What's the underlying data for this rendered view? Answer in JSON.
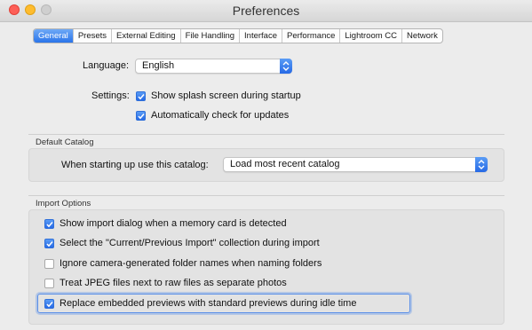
{
  "window": {
    "title": "Preferences"
  },
  "tabs": [
    {
      "label": "General",
      "active": true
    },
    {
      "label": "Presets"
    },
    {
      "label": "External Editing"
    },
    {
      "label": "File Handling"
    },
    {
      "label": "Interface"
    },
    {
      "label": "Performance"
    },
    {
      "label": "Lightroom CC"
    },
    {
      "label": "Network"
    }
  ],
  "language": {
    "label": "Language:",
    "value": "English"
  },
  "settings": {
    "label": "Settings:",
    "splash": {
      "label": "Show splash screen during startup",
      "checked": true
    },
    "updates": {
      "label": "Automatically check for updates",
      "checked": true
    }
  },
  "default_catalog": {
    "title": "Default Catalog",
    "label": "When starting up use this catalog:",
    "value": "Load most recent catalog"
  },
  "import_options": {
    "title": "Import Options",
    "items": [
      {
        "label": "Show import dialog when a memory card is detected",
        "checked": true
      },
      {
        "label": "Select the \"Current/Previous Import\" collection during import",
        "checked": true
      },
      {
        "label": "Ignore camera-generated folder names when naming folders",
        "checked": false
      },
      {
        "label": "Treat JPEG files next to raw files as separate photos",
        "checked": false
      },
      {
        "label": "Replace embedded previews with standard previews during idle time",
        "checked": true
      }
    ]
  },
  "colors": {
    "accent": "#2f7bec",
    "window_bg": "#ececec"
  }
}
